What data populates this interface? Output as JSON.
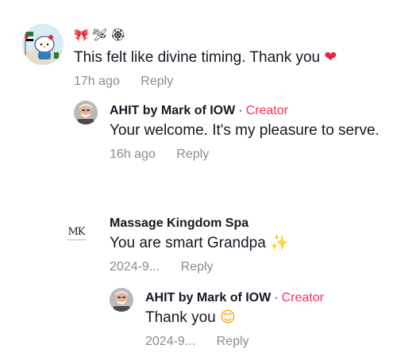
{
  "comments": [
    {
      "username": "",
      "emoji_line": "🎀 🛩 🏵",
      "text": "This felt like divine timing. Thank you",
      "text_emoji": "❤",
      "time": "17h ago",
      "reply_label": "Reply",
      "reply": {
        "username": "AHIT by Mark of IOW",
        "separator": "·",
        "creator_label": "Creator",
        "text": "Your welcome. It's my pleasure to serve.",
        "time": "16h ago",
        "reply_label": "Reply"
      }
    },
    {
      "username": "Massage Kingdom Spa",
      "logo_text": "MK",
      "text": "You are smart Grandpa",
      "text_emoji": "✨",
      "time": "2024-9...",
      "reply_label": "Reply",
      "reply": {
        "username": "AHIT by Mark of IOW",
        "separator": "·",
        "creator_label": "Creator",
        "text": "Thank you",
        "text_emoji": "😊",
        "time": "2024-9...",
        "reply_label": "Reply"
      }
    }
  ]
}
